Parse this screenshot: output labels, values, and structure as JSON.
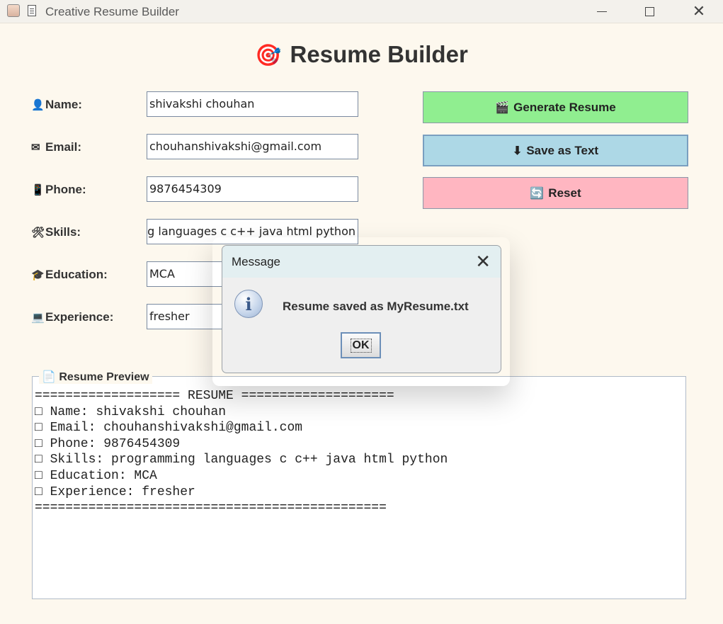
{
  "window": {
    "title": "Creative Resume Builder",
    "app_icon": "java-cup-icon",
    "doc_icon": "document-icon",
    "minimize_glyph": "—",
    "maximize_glyph": "☐",
    "close_glyph": "✕"
  },
  "header": {
    "icon": "🎯",
    "title": "Resume Builder"
  },
  "form": {
    "fields": [
      {
        "icon": "👤",
        "label": "Name:",
        "value": "shivakshi chouhan"
      },
      {
        "icon": "✉",
        "label": "Email:",
        "value": "chouhanshivakshi@gmail.com"
      },
      {
        "icon": "📱",
        "label": "Phone:",
        "value": "9876454309"
      },
      {
        "icon": "🛠",
        "label": "Skills:",
        "value": "programming languages c c++ java html python"
      },
      {
        "icon": "🎓",
        "label": "Education:",
        "value": "MCA"
      },
      {
        "icon": "💻",
        "label": "Experience:",
        "value": "fresher"
      }
    ]
  },
  "actions": {
    "generate": {
      "icon": "🎬",
      "label": "Generate Resume",
      "color": "#90ee90"
    },
    "save": {
      "icon": "⬇",
      "label": "Save as Text",
      "color": "#add8e6"
    },
    "reset": {
      "icon": "🔄",
      "label": "Reset",
      "color": "#ffb6c1"
    }
  },
  "preview": {
    "icon": "📄",
    "title": "Resume Preview",
    "lines": [
      "=================== RESUME ====================",
      "□ Name: shivakshi chouhan",
      "□ Email: chouhanshivakshi@gmail.com",
      "□ Phone: 9876454309",
      "□ Skills: programming languages c c++ java html python",
      "□ Education: MCA",
      "□ Experience: fresher",
      "=============================================="
    ]
  },
  "dialog": {
    "title": "Message",
    "close_glyph": "✕",
    "icon_glyph": "i",
    "message": "Resume saved as MyResume.txt",
    "ok_label": "OK"
  },
  "colors": {
    "background": "#fdf8ee",
    "generate": "#90ee90",
    "save": "#add8e6",
    "reset": "#ffb6c1"
  }
}
